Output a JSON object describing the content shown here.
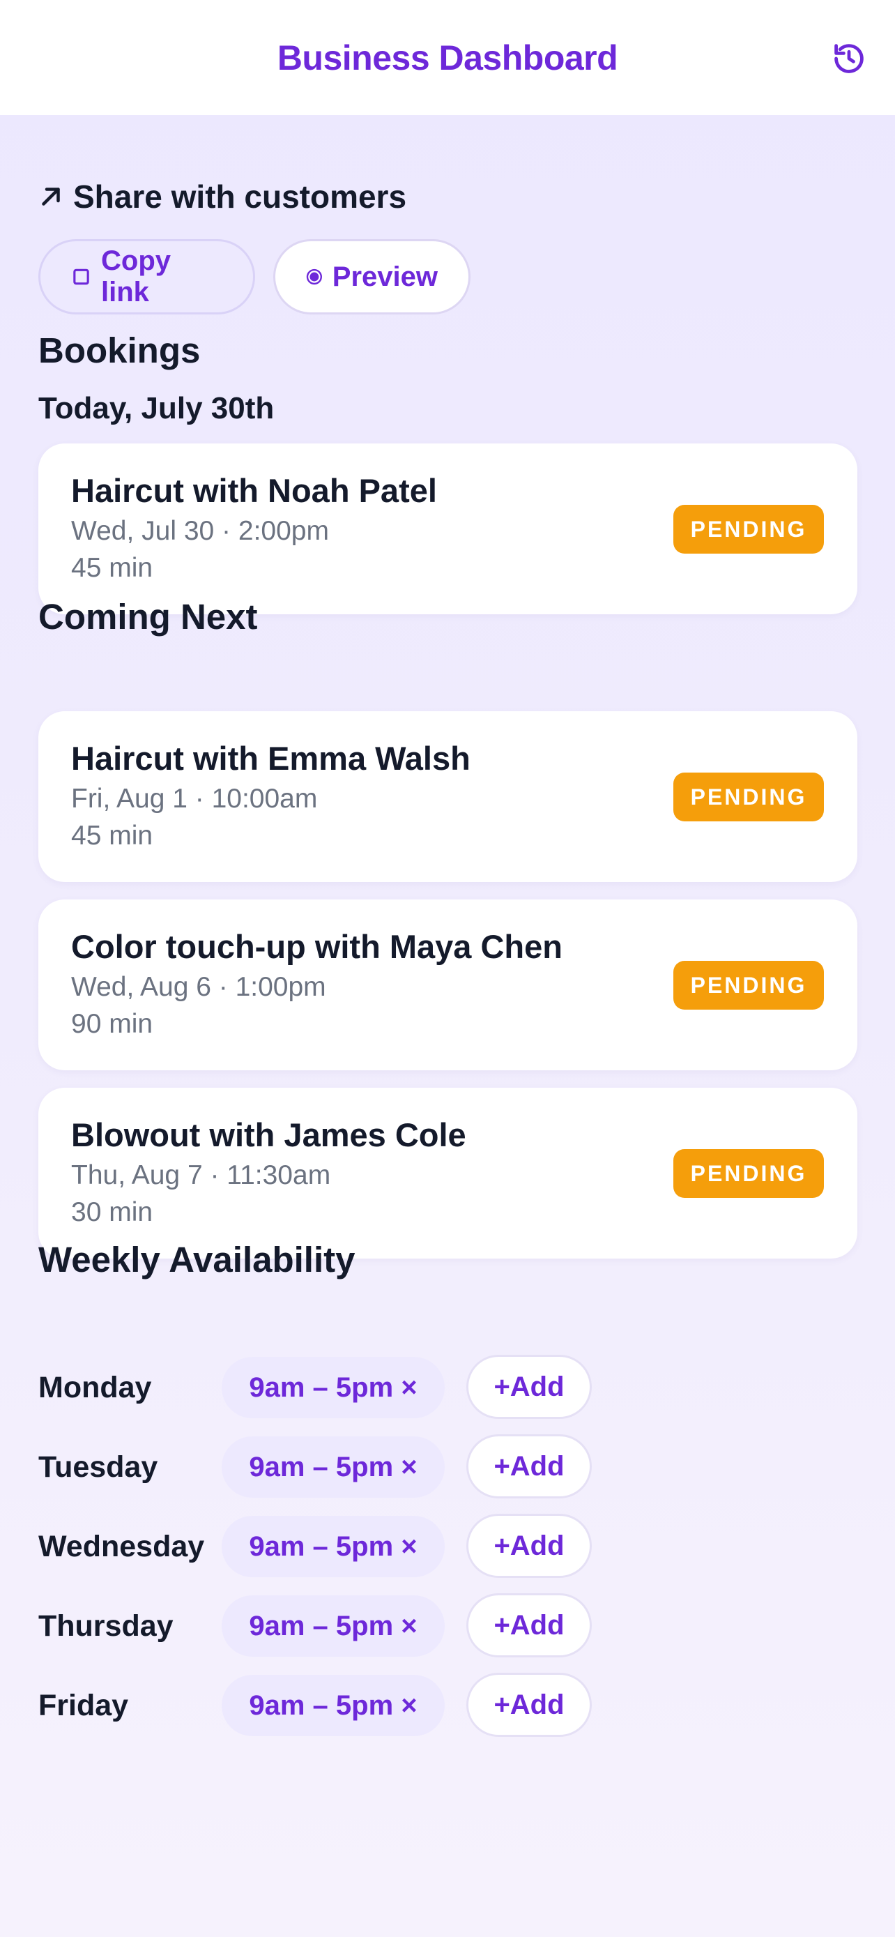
{
  "header": {
    "title": "Business Dashboard",
    "refresh_icon": "refresh-icon"
  },
  "share": {
    "title": "Share with customers",
    "copy_label": "Copy link",
    "preview_label": "Preview"
  },
  "bookings": {
    "title": "Bookings",
    "today_label": "Today, July 30th",
    "today": [
      {
        "title": "Haircut with Noah Patel",
        "when": "Wed, Jul 30 · 2:00pm",
        "duration": "45 min",
        "status": "PENDING"
      }
    ],
    "next_label": "Coming Next",
    "next": [
      {
        "title": "Haircut with Emma Walsh",
        "when": "Fri, Aug 1 · 10:00am",
        "duration": "45 min",
        "status": "PENDING"
      },
      {
        "title": "Color touch-up with Maya Chen",
        "when": "Wed, Aug 6 · 1:00pm",
        "duration": "90 min",
        "status": "PENDING"
      },
      {
        "title": "Blowout with James Cole",
        "when": "Thu, Aug 7 · 11:30am",
        "duration": "30 min",
        "status": "PENDING"
      }
    ]
  },
  "availability": {
    "title": "Weekly Availability",
    "add_label": "+Add",
    "days": [
      {
        "day": "Monday",
        "slot": "9am – 5pm ×"
      },
      {
        "day": "Tuesday",
        "slot": "9am – 5pm ×"
      },
      {
        "day": "Wednesday",
        "slot": "9am – 5pm ×"
      },
      {
        "day": "Thursday",
        "slot": "9am – 5pm ×"
      },
      {
        "day": "Friday",
        "slot": "9am – 5pm ×"
      }
    ]
  },
  "colors": {
    "accent": "#6d28d9",
    "pending": "#f59e0b",
    "text": "#141a2b",
    "muted": "#6b7280"
  }
}
